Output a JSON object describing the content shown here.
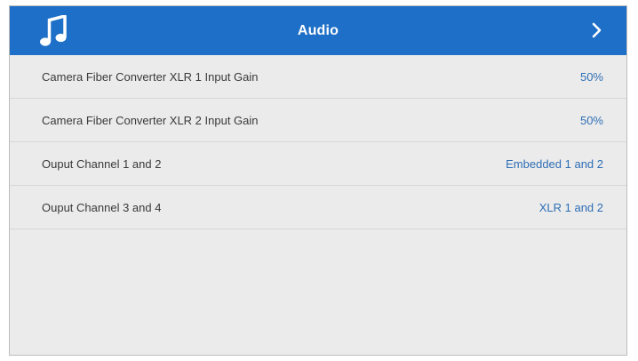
{
  "header": {
    "title": "Audio",
    "icon": "music-note-icon",
    "nav_icon": "chevron-right-icon",
    "accent_color": "#1e6fc7"
  },
  "settings": [
    {
      "label": "Camera Fiber Converter XLR 1 Input Gain",
      "value": "50%"
    },
    {
      "label": "Camera Fiber Converter XLR 2 Input Gain",
      "value": "50%"
    },
    {
      "label": "Ouput Channel 1 and 2",
      "value": "Embedded 1 and 2"
    },
    {
      "label": "Ouput Channel 3 and 4",
      "value": "XLR 1 and 2"
    }
  ]
}
